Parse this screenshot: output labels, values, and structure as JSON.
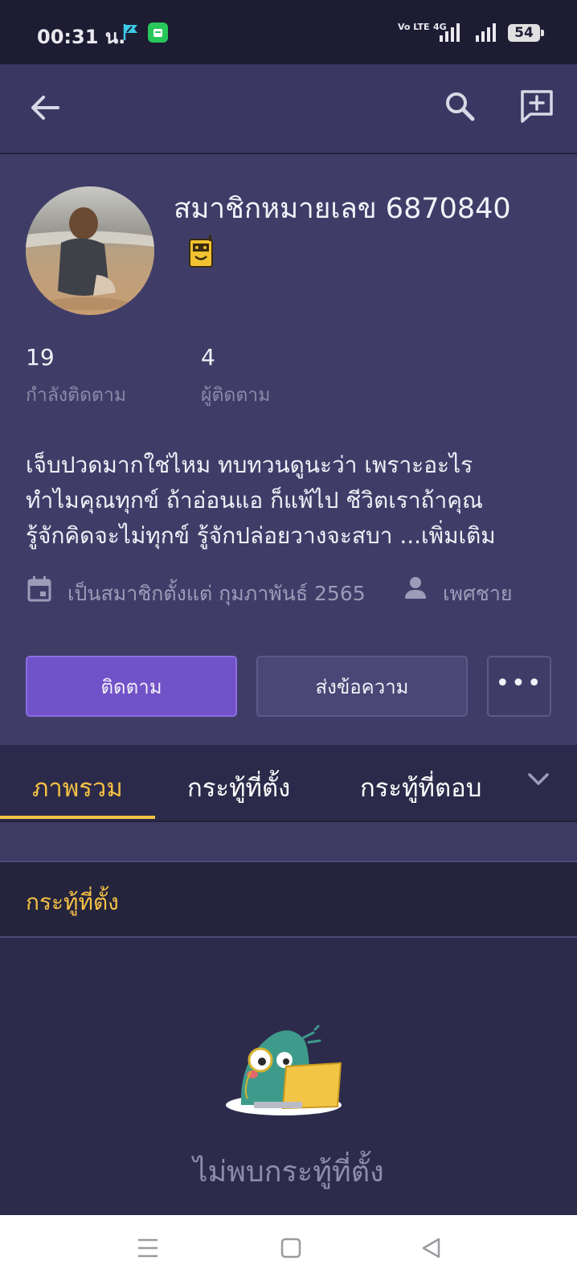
{
  "status_bar": {
    "time": "00:31 น.",
    "network": "Vo LTE",
    "network_4g": "4G",
    "battery": "54"
  },
  "app_bar": {
    "icons": [
      "back-arrow-icon",
      "search-icon",
      "new-post-icon"
    ]
  },
  "profile": {
    "username": "สมาชิกหมายเลข 6870840",
    "badge_icon": "robot-badge-icon",
    "following_count": "19",
    "following_label": "กำลังติดตาม",
    "followers_count": "4",
    "followers_label": "ผู้ติดตาม",
    "bio_line1": "เจ็บปวดมากใช่ไหม ทบทวนดูนะว่า เพราะอะไร",
    "bio_line2": "ทำไมคุณทุกข์ ถ้าอ่อนแอ ก็แพ้ไป ชีวิตเราถ้าคุณ",
    "bio_line3": "รู้จักคิดจะไม่ทุกข์ รู้จักปล่อยวางจะสบา ...เพิ่มเติม",
    "member_since": "เป็นสมาชิกตั้งแต่ กุมภาพันธ์ 2565",
    "gender": "เพศชาย"
  },
  "actions": {
    "follow": "ติดตาม",
    "message": "ส่งข้อความ",
    "more": "•••"
  },
  "tabs": [
    {
      "label": "ภาพรวม",
      "active": true
    },
    {
      "label": "กระทู้ที่ตั้ง",
      "active": false
    },
    {
      "label": "กระทู้ที่ตอบ",
      "active": false
    }
  ],
  "section": {
    "title": "กระทู้ที่ตั้ง",
    "empty_text": "ไม่พบกระทู้ที่ตั้ง"
  },
  "colors": {
    "accent": "#f5c144",
    "primary_button": "#7252c8",
    "background": "#2c2a4a"
  }
}
